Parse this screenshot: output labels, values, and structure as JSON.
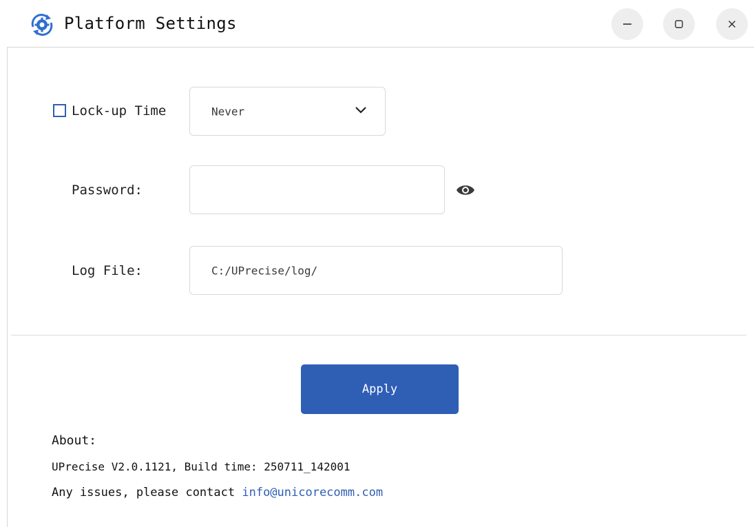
{
  "window": {
    "title": "Platform Settings",
    "accent_color": "#2f5eb5",
    "controls": [
      "minimize-icon",
      "maximize-icon",
      "close-icon"
    ]
  },
  "settings": {
    "lockup": {
      "label": "Lock-up Time",
      "checked": false,
      "selected": "Never"
    },
    "password": {
      "label": "Password:",
      "value": "",
      "toggle_icon": "eye-icon"
    },
    "log_file": {
      "label": "Log File:",
      "value": "C:/UPrecise/log/"
    }
  },
  "actions": {
    "apply_label": "Apply"
  },
  "about": {
    "heading": "About:",
    "version_line": "UPrecise V2.0.1121, Build time: 250711_142001",
    "contact_prefix": "Any issues, please contact",
    "contact_email": "info@unicorecomm.com"
  }
}
